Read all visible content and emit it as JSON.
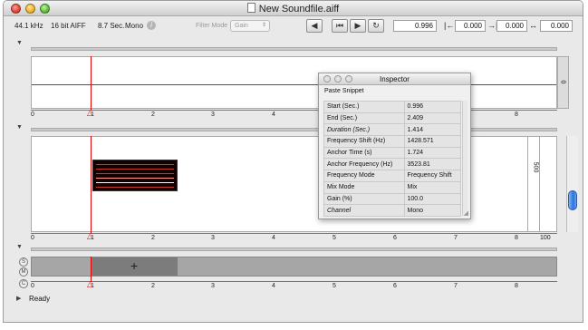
{
  "window": {
    "title": "New Soundfile.aiff"
  },
  "toolbar": {
    "sample_rate": "44.1 kHz",
    "bit_format": "16 bit AIFF",
    "duration": "8.7 Sec.",
    "channels": "Mono",
    "filter_mode_label": "Filter Mode",
    "filter_mode_value": "Gain",
    "position_value": "0.996",
    "start_marker_value": "0.000",
    "end_marker_value": "0.000",
    "length_value": "0.000"
  },
  "ruler": {
    "ticks": [
      "0",
      "1",
      "2",
      "3",
      "4",
      "5",
      "6",
      "7",
      "8"
    ]
  },
  "waveform_panel": {
    "axis_value": "0"
  },
  "spectrum_panel": {
    "freq_axis": "500",
    "bottom_value": "100"
  },
  "inspector": {
    "title": "Inspector",
    "paste_label": "Paste Snippet",
    "rows": [
      {
        "label": "Start (Sec.)",
        "value": "0.996",
        "italic": false
      },
      {
        "label": "End (Sec.)",
        "value": "2.409",
        "italic": false
      },
      {
        "label": "Duration (Sec.)",
        "value": "1.414",
        "italic": true
      },
      {
        "label": "Frequency Shift (Hz)",
        "value": "1428.571",
        "italic": false
      },
      {
        "label": "Anchor Time (s)",
        "value": "1.724",
        "italic": false
      },
      {
        "label": "Anchor Frequency (Hz)",
        "value": "3523.81",
        "italic": false
      },
      {
        "label": "Frequency Mode",
        "value": "Frequency Shift",
        "italic": false
      },
      {
        "label": "Mix Mode",
        "value": "Mix",
        "italic": false
      },
      {
        "label": "Gain (%)",
        "value": "100.0",
        "italic": false
      },
      {
        "label": "Channel",
        "value": "Mono",
        "italic": true
      }
    ]
  },
  "status": {
    "text": "Ready"
  },
  "colors": {
    "cursor": "#e00000",
    "waveform_line": "#3c3cff",
    "scroll_thumb": "#2c73d9"
  }
}
